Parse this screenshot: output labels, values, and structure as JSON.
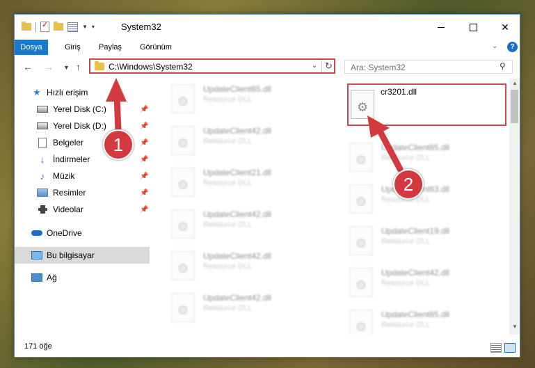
{
  "window": {
    "title": "System32",
    "controls": {
      "minimize": "—",
      "maximize": "□",
      "close": "✕"
    }
  },
  "ribbon": {
    "tabs": [
      "Dosya",
      "Giriş",
      "Paylaş",
      "Görünüm"
    ],
    "help": "?"
  },
  "address": {
    "path": "C:\\Windows\\System32",
    "refresh": "↻"
  },
  "search": {
    "placeholder": "Ara: System32"
  },
  "nav": {
    "quick_access": "Hızlı erişim",
    "items": [
      {
        "label": "Yerel Disk (C:)",
        "icon": "drive-icon"
      },
      {
        "label": "Yerel Disk (D:)",
        "icon": "drive-icon"
      },
      {
        "label": "Belgeler",
        "icon": "documents-icon"
      },
      {
        "label": "İndirmeler",
        "icon": "downloads-icon"
      },
      {
        "label": "Müzik",
        "icon": "music-icon"
      },
      {
        "label": "Resimler",
        "icon": "pictures-icon"
      },
      {
        "label": "Videolar",
        "icon": "videos-icon"
      }
    ],
    "onedrive": "OneDrive",
    "this_pc": "Bu bilgisayar",
    "network": "Ağ"
  },
  "files": {
    "left": [
      {
        "name": "UpdateClient65.dll",
        "type": "Resource DLL"
      },
      {
        "name": "UpdateClient42.dll",
        "type": "Resource DLL"
      },
      {
        "name": "UpdateClient21.dll",
        "type": "Resource DLL"
      },
      {
        "name": "UpdateClient42.dll",
        "type": "Resource DLL"
      },
      {
        "name": "UpdateClient42.dll",
        "type": "Resource DLL"
      },
      {
        "name": "UpdateClient42.dll",
        "type": "Resource DLL"
      }
    ],
    "right": [
      {
        "name": "cr3201.dll",
        "type": ""
      },
      {
        "name": "UpdateClient65.dll",
        "type": "Resource DLL"
      },
      {
        "name": "UpdateClient63.dll",
        "type": "Resource DLL"
      },
      {
        "name": "UpdateClient19.dll",
        "type": "Resource DLL"
      },
      {
        "name": "UpdateClient42.dll",
        "type": "Resource DLL"
      },
      {
        "name": "UpdateClient65.dll",
        "type": "Resource DLL"
      }
    ]
  },
  "status": {
    "count": "171 öğe"
  },
  "annotations": {
    "badge1": "1",
    "badge2": "2",
    "color": "#d23a3f"
  }
}
